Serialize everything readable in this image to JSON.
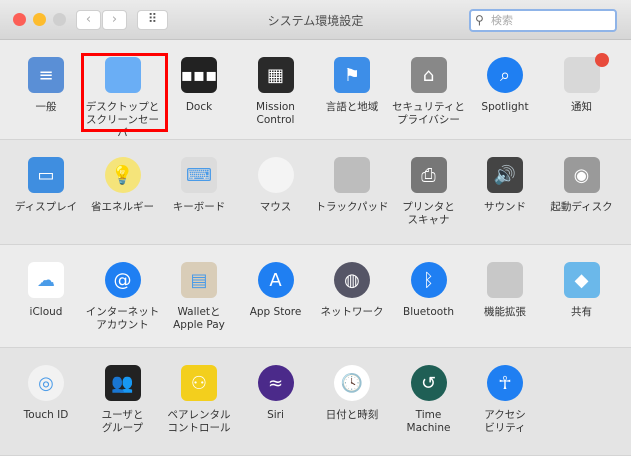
{
  "window": {
    "title": "システム環境設定",
    "back": "‹",
    "forward": "›",
    "grid": "⠿",
    "search_placeholder": "検索"
  },
  "rows": [
    [
      {
        "label": "一般",
        "icon": "general-icon",
        "color": "#5a8fd6",
        "glyph": "≡"
      },
      {
        "label": "デスクトップと\nスクリーンセーバ",
        "icon": "desktop-icon",
        "color": "#6aaef5",
        "glyph": "",
        "selected": true
      },
      {
        "label": "Dock",
        "icon": "dock-icon",
        "color": "#222",
        "glyph": "▪▪▪"
      },
      {
        "label": "Mission\nControl",
        "icon": "mission-control-icon",
        "color": "#2a2a2a",
        "glyph": "▦"
      },
      {
        "label": "言語と地域",
        "icon": "language-flag-icon",
        "color": "#3d8ee8",
        "glyph": "⚑"
      },
      {
        "label": "セキュリティと\nプライバシー",
        "icon": "security-house-icon",
        "color": "#888",
        "glyph": "⌂"
      },
      {
        "label": "Spotlight",
        "icon": "spotlight-icon",
        "color": "#1f7ff2",
        "glyph": "⌕"
      },
      {
        "label": "通知",
        "icon": "notifications-icon",
        "color": "#d8d8d8",
        "glyph": ""
      }
    ],
    [
      {
        "label": "ディスプレイ",
        "icon": "display-icon",
        "color": "#3f8ee0",
        "glyph": "▭"
      },
      {
        "label": "省エネルギー",
        "icon": "bulb-icon",
        "color": "#f5e47a",
        "glyph": "💡"
      },
      {
        "label": "キーボード",
        "icon": "keyboard-icon",
        "color": "#dcdcdc",
        "glyph": "⌨"
      },
      {
        "label": "マウス",
        "icon": "mouse-icon",
        "color": "#f4f4f4",
        "glyph": ""
      },
      {
        "label": "トラックパッド",
        "icon": "trackpad-icon",
        "color": "#bdbdbd",
        "glyph": ""
      },
      {
        "label": "プリンタと\nスキャナ",
        "icon": "printer-icon",
        "color": "#777",
        "glyph": "⎙"
      },
      {
        "label": "サウンド",
        "icon": "speaker-icon",
        "color": "#444",
        "glyph": "🔊"
      },
      {
        "label": "起動ディスク",
        "icon": "disk-icon",
        "color": "#9a9a9a",
        "glyph": "◉"
      }
    ],
    [
      {
        "label": "iCloud",
        "icon": "icloud-icon",
        "color": "#ffffff",
        "glyph": "☁"
      },
      {
        "label": "インターネット\nアカウント",
        "icon": "at-icon",
        "color": "#1f7ff2",
        "glyph": "@"
      },
      {
        "label": "Walletと\nApple Pay",
        "icon": "wallet-icon",
        "color": "#d9cdb8",
        "glyph": "▤"
      },
      {
        "label": "App Store",
        "icon": "app-store-icon",
        "color": "#1f7ff2",
        "glyph": "A"
      },
      {
        "label": "ネットワーク",
        "icon": "network-globe-icon",
        "color": "#556",
        "glyph": "◍"
      },
      {
        "label": "Bluetooth",
        "icon": "bluetooth-icon",
        "color": "#1f7ff2",
        "glyph": "ᛒ"
      },
      {
        "label": "機能拡張",
        "icon": "extensions-puzzle-icon",
        "color": "#c8c8c8",
        "glyph": ""
      },
      {
        "label": "共有",
        "icon": "sharing-folder-icon",
        "color": "#6bb8ea",
        "glyph": "◆"
      }
    ],
    [
      {
        "label": "Touch ID",
        "icon": "fingerprint-icon",
        "color": "#f2f2f2",
        "glyph": "◎"
      },
      {
        "label": "ユーザと\nグループ",
        "icon": "users-icon",
        "color": "#222",
        "glyph": "👥"
      },
      {
        "label": "ペアレンタル\nコントロール",
        "icon": "parental-controls-icon",
        "color": "#f3cf1d",
        "glyph": "⚇"
      },
      {
        "label": "Siri",
        "icon": "siri-icon",
        "color": "#4b2a8a",
        "glyph": "≈"
      },
      {
        "label": "日付と時刻",
        "icon": "clock-icon",
        "color": "#ffffff",
        "glyph": "🕓"
      },
      {
        "label": "Time\nMachine",
        "icon": "time-machine-icon",
        "color": "#1f5f55",
        "glyph": "↺"
      },
      {
        "label": "アクセシ\nビリティ",
        "icon": "accessibility-icon",
        "color": "#1f7ff2",
        "glyph": "☥"
      }
    ]
  ]
}
